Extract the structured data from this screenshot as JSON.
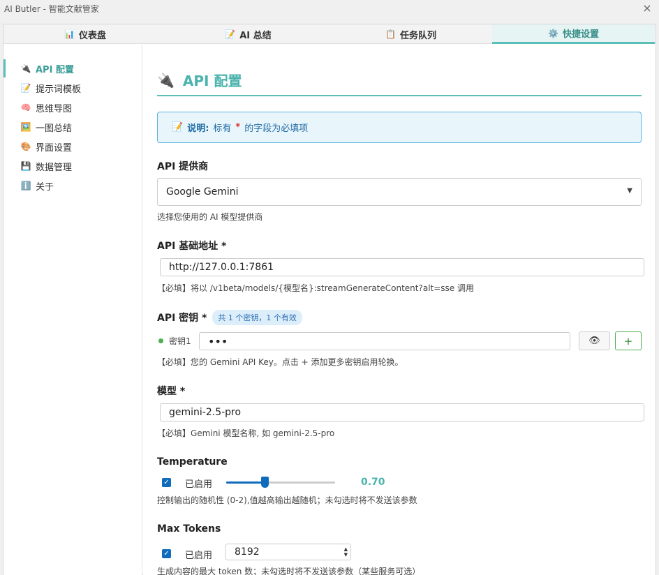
{
  "window": {
    "title": "AI Butler - 智能文献管家",
    "close_icon": "×"
  },
  "tabs": [
    {
      "label": "仪表盘",
      "icon": "📊"
    },
    {
      "label": "AI 总结",
      "icon": "📝"
    },
    {
      "label": "任务队列",
      "icon": "📋"
    },
    {
      "label": "快捷设置",
      "icon": "⚙️"
    }
  ],
  "sidebar": {
    "items": [
      {
        "label": "API 配置",
        "icon": "🔌"
      },
      {
        "label": "提示词模板",
        "icon": "📝"
      },
      {
        "label": "思维导图",
        "icon": "🧠"
      },
      {
        "label": "一图总结",
        "icon": "🖼️"
      },
      {
        "label": "界面设置",
        "icon": "🎨"
      },
      {
        "label": "数据管理",
        "icon": "💾"
      },
      {
        "label": "关于",
        "icon": "ℹ️"
      }
    ]
  },
  "page": {
    "icon": "🔌",
    "title": "API 配置",
    "notice": {
      "icon": "📝",
      "prefix": "说明:",
      "text_before": "标有",
      "star": "*",
      "text_after": "的字段为必填项"
    }
  },
  "provider": {
    "label": "API 提供商",
    "selected": "Google Gemini",
    "arrow": "▼",
    "hint": "选择您使用的 AI 模型提供商"
  },
  "base_url": {
    "label": "API 基础地址 *",
    "value": "http://127.0.0.1:7861",
    "hint": "【必填】将以 /v1beta/models/{模型名}:streamGenerateContent?alt=sse 调用"
  },
  "api_key": {
    "label": "API 密钥 *",
    "badge": "共 1 个密钥，1 个有效",
    "key_label": "密钥1",
    "value": "•••",
    "show_icon": "👁",
    "add_label": "+",
    "hint": "【必填】您的 Gemini API Key。点击 + 添加更多密钥启用轮换。"
  },
  "model": {
    "label": "模型 *",
    "value": "gemini-2.5-pro",
    "hint": "【必填】Gemini 模型名称, 如 gemini-2.5-pro"
  },
  "temperature": {
    "label": "Temperature",
    "enabled_label": "已启用",
    "checked": true,
    "level_fraction": 0.35,
    "value": "0.70",
    "hint": "控制输出的随机性 (0-2),值越高输出越随机；未勾选时将不发送该参数"
  },
  "max_tokens": {
    "label": "Max Tokens",
    "enabled_label": "已启用",
    "checked": true,
    "value": "8192",
    "hint": "生成内容的最大 token 数；未勾选时将不发送该参数（某些服务可选）"
  },
  "colors": {
    "accent": "#4bb3ad",
    "primary": "#0f6cbd",
    "notice_border": "#59b4df",
    "valid": "#4cb050"
  }
}
